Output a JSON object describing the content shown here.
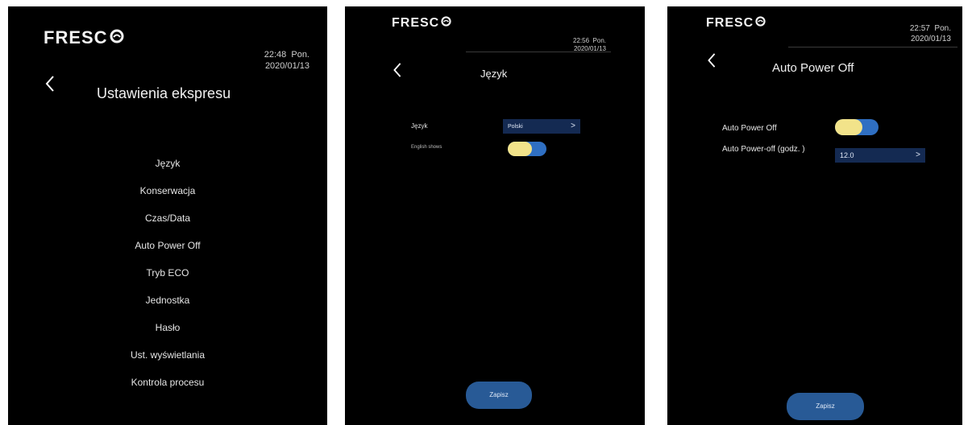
{
  "brand": {
    "logo_text": "FRESC",
    "logo_mark": "wifi-arc-icon"
  },
  "screens": [
    {
      "time": "22:48",
      "day": "Pon.",
      "date": "2020/01/13",
      "title": "Ustawienia ekspresu",
      "menu": [
        "Język",
        "Konserwacja",
        "Czas/Data",
        "Auto Power Off",
        "Tryb ECO",
        "Jednostka",
        "Hasło",
        "Ust. wyświetlania",
        "Kontrola procesu"
      ]
    },
    {
      "time": "22:56",
      "day": "Pon.",
      "date": "2020/01/13",
      "title": "Język",
      "language_label": "Język",
      "language_value": "Polski",
      "english_label": "English shows",
      "english_toggle_on": true,
      "save_label": "Zapisz"
    },
    {
      "time": "22:57",
      "day": "Pon.",
      "date": "2020/01/13",
      "title": "Auto Power Off",
      "apo_label": "Auto Power Off",
      "apo_toggle_on": true,
      "apo_time_label": "Auto Power-off (godz. )",
      "apo_time_value": "12.0",
      "save_label": "Zapisz"
    }
  ],
  "colors": {
    "background": "#000000",
    "toggle_knob": "#f2e38a",
    "toggle_track": "#2f6fc2",
    "select_bg": "#142a52",
    "button_bg": "#285a96"
  }
}
